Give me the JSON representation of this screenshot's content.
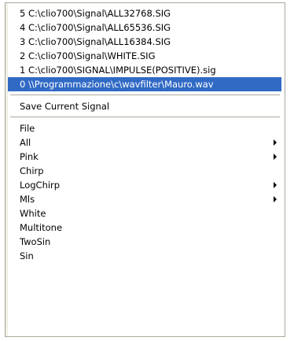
{
  "menu": {
    "recent_signals": [
      "5 C:\\clio700\\Signal\\ALL32768.SIG",
      "4 C:\\clio700\\Signal\\ALL65536.SIG",
      "3 C:\\clio700\\Signal\\ALL16384.SIG",
      "2 C:\\clio700\\Signal\\WHITE.SIG",
      "1 C:\\clio700\\SIGNAL\\IMPULSE(POSITIVE).sig",
      "0 \\\\Programmazione\\c\\wavfilter\\Mauro.wav"
    ],
    "save_current_signal": "Save Current Signal",
    "signal_types": [
      {
        "label": "File",
        "submenu": false
      },
      {
        "label": "All",
        "submenu": true
      },
      {
        "label": "Pink",
        "submenu": true
      },
      {
        "label": "Chirp",
        "submenu": false
      },
      {
        "label": "LogChirp",
        "submenu": true
      },
      {
        "label": "Mls",
        "submenu": true
      },
      {
        "label": "White",
        "submenu": false
      },
      {
        "label": "Multitone",
        "submenu": false
      },
      {
        "label": "TwoSin",
        "submenu": false
      },
      {
        "label": "Sin",
        "submenu": false
      }
    ],
    "selected_recent_index": 5,
    "colors": {
      "highlight": "#316ac5",
      "highlight_text": "#ffffff",
      "border": "#aca899"
    }
  }
}
